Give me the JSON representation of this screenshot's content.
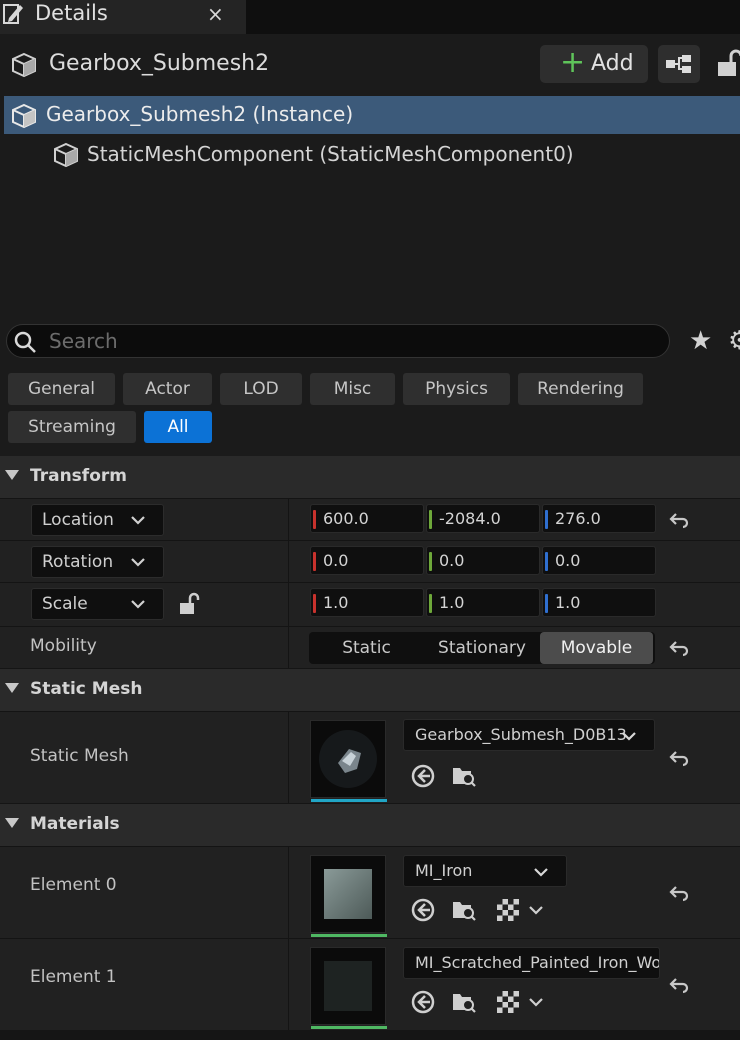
{
  "tab": {
    "title": "Details",
    "close": "×"
  },
  "header": {
    "actor_name": "Gearbox_Submesh2",
    "add_label": "Add"
  },
  "tree": {
    "root": "Gearbox_Submesh2 (Instance)",
    "child": "StaticMeshComponent (StaticMeshComponent0)"
  },
  "search": {
    "placeholder": "Search"
  },
  "filters": [
    "General",
    "Actor",
    "LOD",
    "Misc",
    "Physics",
    "Rendering",
    "Streaming",
    "All"
  ],
  "filter_active": "All",
  "transform": {
    "title": "Transform",
    "location": {
      "label": "Location",
      "x": "600.0",
      "y": "-2084.0",
      "z": "276.0"
    },
    "rotation": {
      "label": "Rotation",
      "x": "0.0",
      "y": "0.0",
      "z": "0.0"
    },
    "scale": {
      "label": "Scale",
      "x": "1.0",
      "y": "1.0",
      "z": "1.0"
    },
    "mobility": {
      "label": "Mobility",
      "options": [
        "Static",
        "Stationary",
        "Movable"
      ],
      "selected": "Movable"
    }
  },
  "static_mesh": {
    "title": "Static Mesh",
    "label": "Static Mesh",
    "asset": "Gearbox_Submesh_D0B13"
  },
  "materials": {
    "title": "Materials",
    "element0": {
      "label": "Element 0",
      "asset": "MI_Iron"
    },
    "element1": {
      "label": "Element 1",
      "asset": "MI_Scratched_Painted_Iron_Wor"
    }
  },
  "colors": {
    "accent": "#0c72d6",
    "selection": "#3c5a7a",
    "x_axis": "#c8322d",
    "y_axis": "#6ea83a",
    "z_axis": "#2f6fd0",
    "add_plus": "#5fc45a"
  }
}
